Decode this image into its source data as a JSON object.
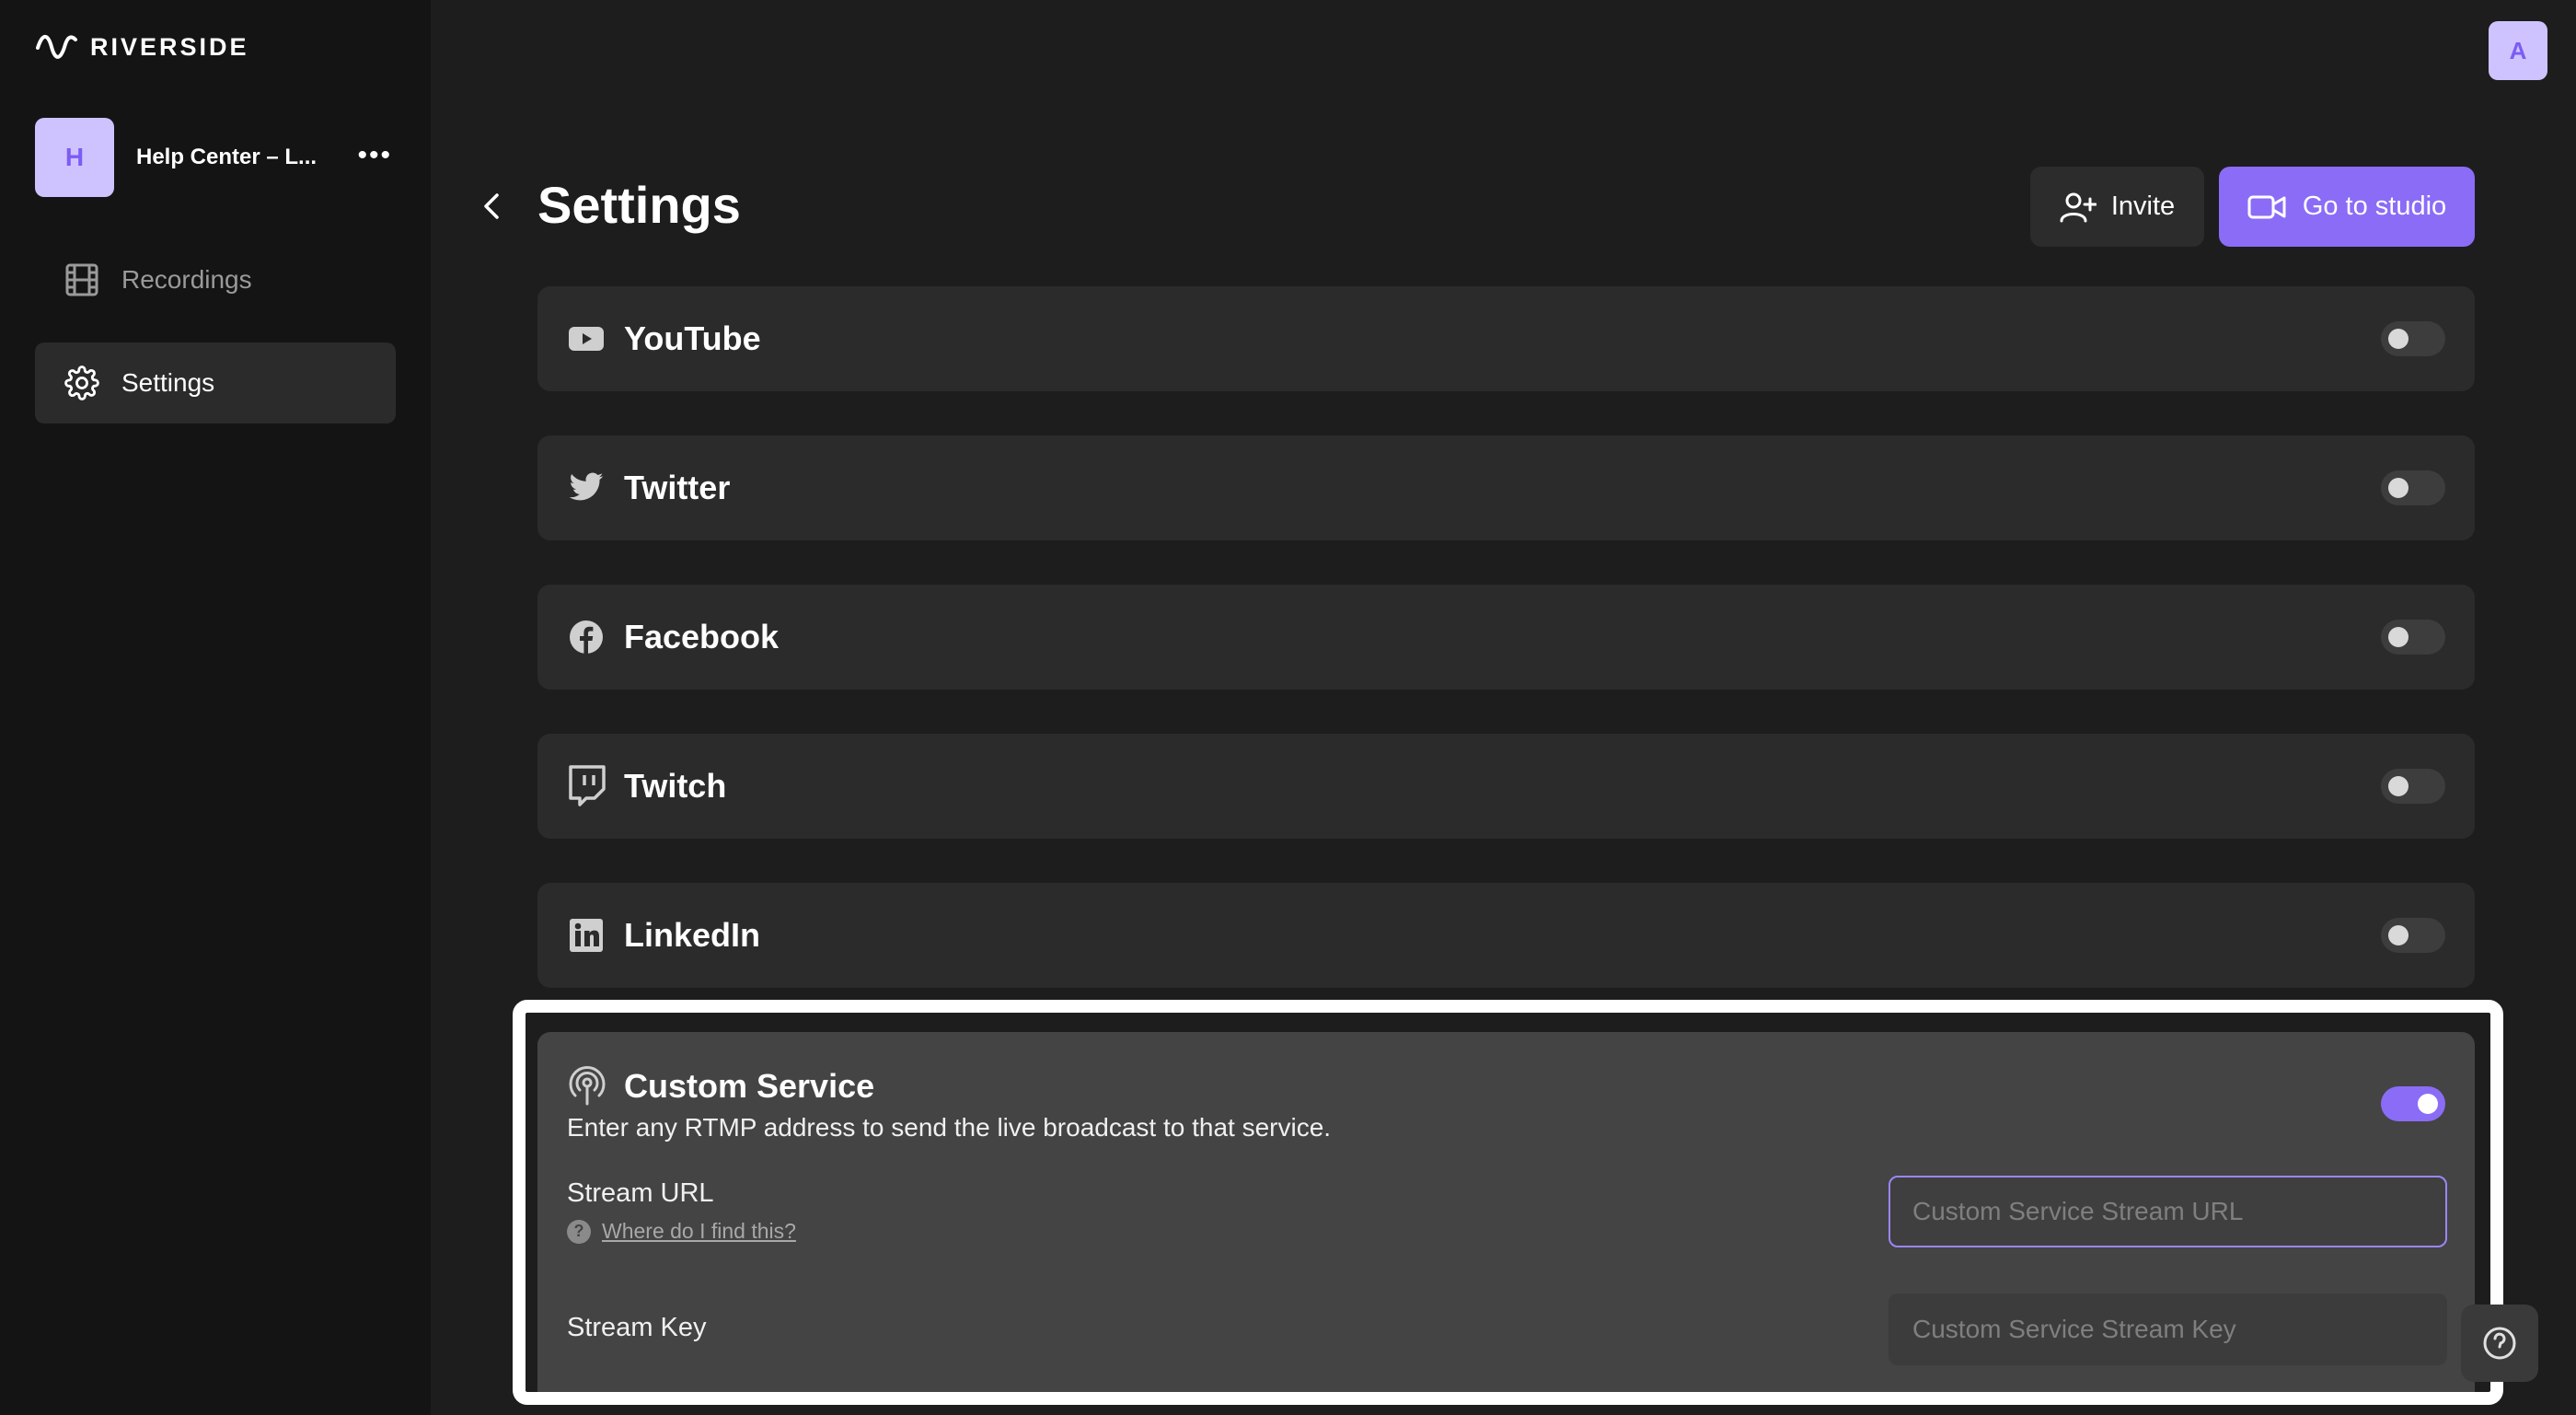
{
  "sidebar": {
    "logo_text": "RIVERSIDE",
    "workspace": {
      "initial": "H",
      "name": "Help Center – L...",
      "more": "•••"
    },
    "items": [
      {
        "label": "Recordings",
        "icon": "film-icon"
      },
      {
        "label": "Settings",
        "icon": "gear-icon"
      }
    ]
  },
  "header": {
    "user_initial": "A",
    "title": "Settings",
    "invite_label": "Invite",
    "studio_label": "Go to studio"
  },
  "services": [
    {
      "label": "YouTube",
      "icon": "youtube-icon",
      "enabled": false
    },
    {
      "label": "Twitter",
      "icon": "twitter-icon",
      "enabled": false
    },
    {
      "label": "Facebook",
      "icon": "facebook-icon",
      "enabled": false
    },
    {
      "label": "Twitch",
      "icon": "twitch-icon",
      "enabled": false
    },
    {
      "label": "LinkedIn",
      "icon": "linkedin-icon",
      "enabled": false
    }
  ],
  "custom_service": {
    "title": "Custom Service",
    "description": "Enter any RTMP address to send the live broadcast to that service.",
    "enabled": true,
    "stream_url_label": "Stream URL",
    "help_link": "Where do I find this?",
    "stream_url_placeholder": "Custom Service Stream URL",
    "stream_key_label": "Stream Key",
    "stream_key_placeholder": "Custom Service Stream Key"
  },
  "colors": {
    "accent": "#8b6cf6",
    "background": "#1d1d1d",
    "sidebar": "#141414",
    "card": "#2b2b2b"
  }
}
